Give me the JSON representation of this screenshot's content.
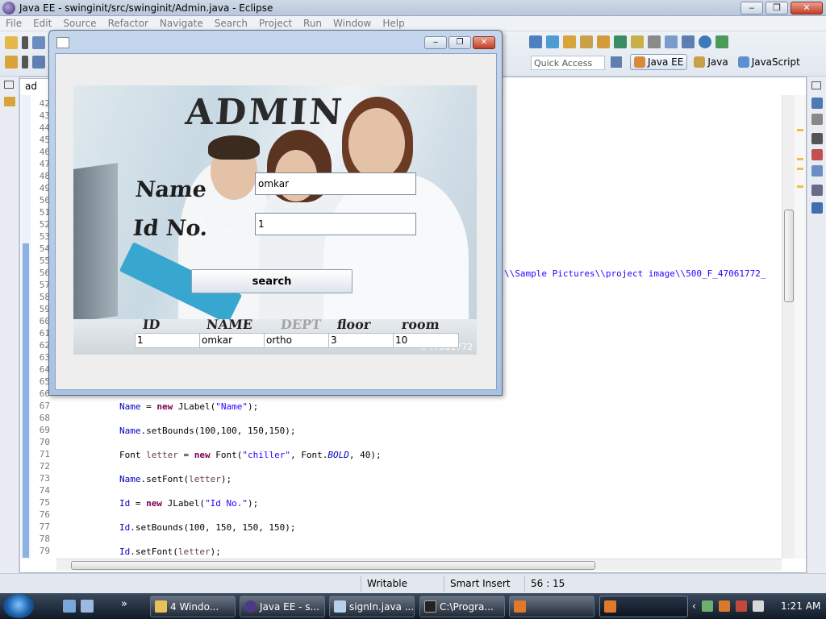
{
  "window": {
    "title": "Java EE - swinginit/src/swinginit/Admin.java - Eclipse",
    "minimize": "‒",
    "maximize": "❐",
    "close": "✕"
  },
  "menu": [
    "File",
    "Edit",
    "Source",
    "Refactor",
    "Navigate",
    "Search",
    "Project",
    "Run",
    "Window",
    "Help"
  ],
  "quick_access": {
    "placeholder": "Quick Access"
  },
  "perspectives": [
    "Java EE",
    "Java",
    "JavaScript"
  ],
  "editor": {
    "tab_label": "ad",
    "line_numbers": [
      "42",
      "43",
      "44",
      "45",
      "46",
      "47",
      "48",
      "49",
      "50",
      "51",
      "52",
      "53",
      "54",
      "55",
      "56",
      "57",
      "58",
      "59",
      "60",
      "61",
      "62",
      "63",
      "64",
      "65",
      "66",
      "67",
      "68",
      "69",
      "70",
      "71",
      "72",
      "73",
      "74",
      "75",
      "76",
      "77",
      "78",
      "79"
    ],
    "fragment": "\\\\Sample Pictures\\\\project image\\\\500_F_47061772_",
    "code": {
      "l67": {
        "field": "Name",
        "mid": " = ",
        "kw": "new",
        "rest": " JLabel(",
        "str": "\"Name\"",
        "end": ");"
      },
      "l69": {
        "field": "Name",
        "rest": ".setBounds(100,100, 150,150);"
      },
      "l71": {
        "type": "Font ",
        "var": "letter",
        "mid": " = ",
        "kw": "new",
        "rest": " Font(",
        "str": "\"chiller\"",
        "rest2": ", Font.",
        "bold": "BOLD",
        "end": ", 40);"
      },
      "l73": {
        "field": "Name",
        "rest": ".setFont(",
        "var": "letter",
        "end": ");"
      },
      "l75": {
        "field": "Id",
        "mid": " = ",
        "kw": "new",
        "rest": " JLabel(",
        "str": "\"Id No.\"",
        "end": ");"
      },
      "l77": {
        "field": "Id",
        "rest": ".setBounds(100, 150, 150, 150);"
      },
      "l79": {
        "field": "Id",
        "rest": ".setFont(",
        "var": "letter",
        "end": ");"
      }
    }
  },
  "status": {
    "writable": "Writable",
    "insert_mode": "Smart Insert",
    "position": "56 : 15"
  },
  "dialog": {
    "title_text": "ADMIN",
    "name_label": "Name",
    "id_label": "Id No.",
    "name_value": "omkar",
    "id_value": "1",
    "search_label": "search",
    "columns": [
      "ID",
      "NAME",
      "DEPT",
      "floor",
      "room"
    ],
    "row": [
      "1",
      "omkar",
      "ortho",
      "3",
      "10"
    ],
    "watermark": "#47061772",
    "photo_watermark": "A C"
  },
  "taskbar": {
    "tasks": [
      "4 Windo...",
      "Java EE - s...",
      "signIn.java ...",
      "C:\\Progra...",
      "",
      ""
    ],
    "more": "»",
    "tray_chevron": "‹",
    "clock": "1:21 AM"
  },
  "colors": {
    "keyword": "#7f0055",
    "field": "#0000c0",
    "string": "#2a00ff"
  }
}
